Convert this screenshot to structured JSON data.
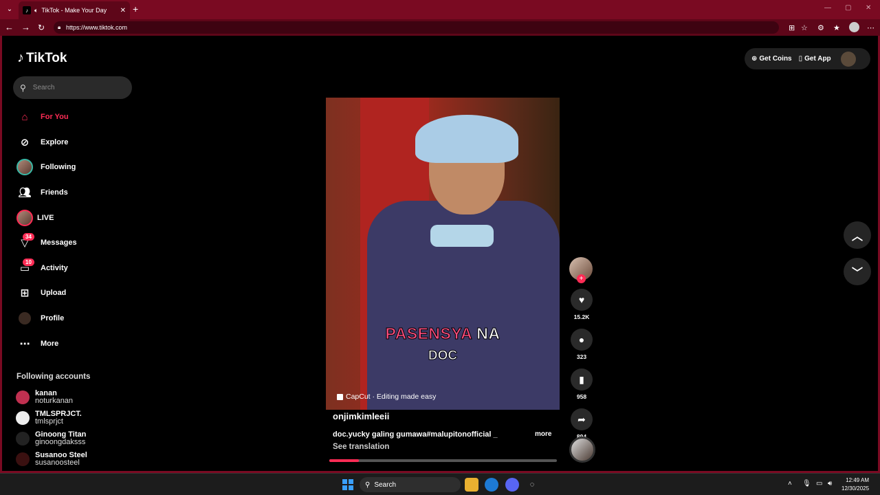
{
  "browser": {
    "tab_title": "TikTok - Make Your Day",
    "url": "https://www.tiktok.com"
  },
  "sidebar": {
    "logo": "TikTok",
    "search_placeholder": "Search",
    "items": [
      {
        "label": "For You",
        "icon": "home-icon"
      },
      {
        "label": "Explore",
        "icon": "compass-icon"
      },
      {
        "label": "Following",
        "icon": "following-avatar"
      },
      {
        "label": "Friends",
        "icon": "friends-icon"
      },
      {
        "label": "LIVE",
        "icon": "live-avatar"
      },
      {
        "label": "Messages",
        "icon": "messages-icon",
        "badge": "34"
      },
      {
        "label": "Activity",
        "icon": "activity-icon",
        "badge": "10"
      },
      {
        "label": "Upload",
        "icon": "upload-icon"
      },
      {
        "label": "Profile",
        "icon": "profile-avatar"
      },
      {
        "label": "More",
        "icon": "more-icon"
      }
    ],
    "following_title": "Following accounts",
    "following": [
      {
        "name": "kanan",
        "handle": "noturkanan"
      },
      {
        "name": "TMLSPRJCT.",
        "handle": "tmlsprjct"
      },
      {
        "name": "Ginoong Titan",
        "handle": "ginoongdaksss"
      },
      {
        "name": "Susanoo Steel",
        "handle": "susanoosteel"
      }
    ]
  },
  "topright": {
    "get_coins": "Get Coins",
    "get_app": "Get App"
  },
  "video": {
    "caption_pink": "PASENSYA",
    "caption_white": "NA",
    "caption_line2": "DOC",
    "capcut": "CapCut · Editing made easy",
    "author": "onjimkimleeii",
    "description": "doc.yucky galing gumawa#malupitonofficial _",
    "more": "more",
    "translation": "See translation",
    "progress": 0.13
  },
  "actions": {
    "likes": "15.2K",
    "comments": "323",
    "saves": "958",
    "shares": "894"
  },
  "taskbar": {
    "search": "Search",
    "time": "12:49 AM",
    "date": "12/30/2025"
  }
}
